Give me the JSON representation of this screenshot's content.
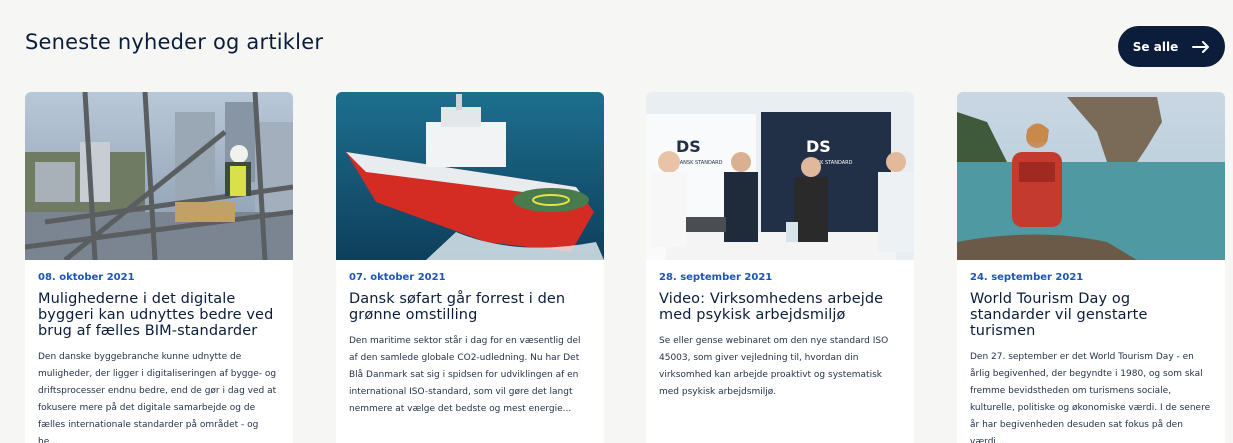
{
  "section": {
    "title": "Seneste nyheder og artikler",
    "see_all_label": "Se alle"
  },
  "articles": [
    {
      "date": "08. oktober 2021",
      "title": "Mulighederne i det digitale byggeri kan udnyttes bedre ved brug af fælles BIM-standarder",
      "excerpt": "Den danske byggebranche kunne udnytte de muligheder, der ligger i digitaliseringen af bygge- og driftsprocesser endnu bedre, end de gør i dag ved at fokusere mere på det digitale samarbejde og de fælles internationale standarder på området - og he..."
    },
    {
      "date": "07. oktober 2021",
      "title": "Dansk søfart går forrest i den grønne omstilling",
      "excerpt": "Den maritime sektor står i dag for en væsentlig del af den samlede globale CO2-udledning. Nu har Det Blå Danmark sat sig i spidsen for udviklingen af en international ISO-standard, som vil gøre det langt nemmere at vælge det bedste og mest energie..."
    },
    {
      "date": "28. september 2021",
      "title": "Video: Virksomhedens arbejde med psykisk arbejdsmiljø",
      "excerpt": "Se eller gense webinaret om den nye standard ISO 45003, som giver vejledning til, hvordan din virksomhed kan arbejde proaktivt og systematisk med psykisk arbejdsmiljø.",
      "image_text": [
        "DS",
        "DS",
        "DANSK STANDARD",
        "DANSK STANDARD"
      ]
    },
    {
      "date": "24. september 2021",
      "title": "World Tourism Day og standarder vil genstarte turismen",
      "excerpt": "Den 27. september er det World Tourism Day - en årlig begivenhed, der begyndte i 1980, og som skal fremme bevidstheden om turismens sociale, kulturelle, politiske og økonomiske værdi. I de senere år har begivenheden desuden sat fokus på den værdi,..."
    }
  ],
  "colors": {
    "navy": "#0b1d3a",
    "date_blue": "#1a55b8",
    "background": "#f6f6f4"
  },
  "icons": {
    "see_all": "arrow-right-icon"
  }
}
